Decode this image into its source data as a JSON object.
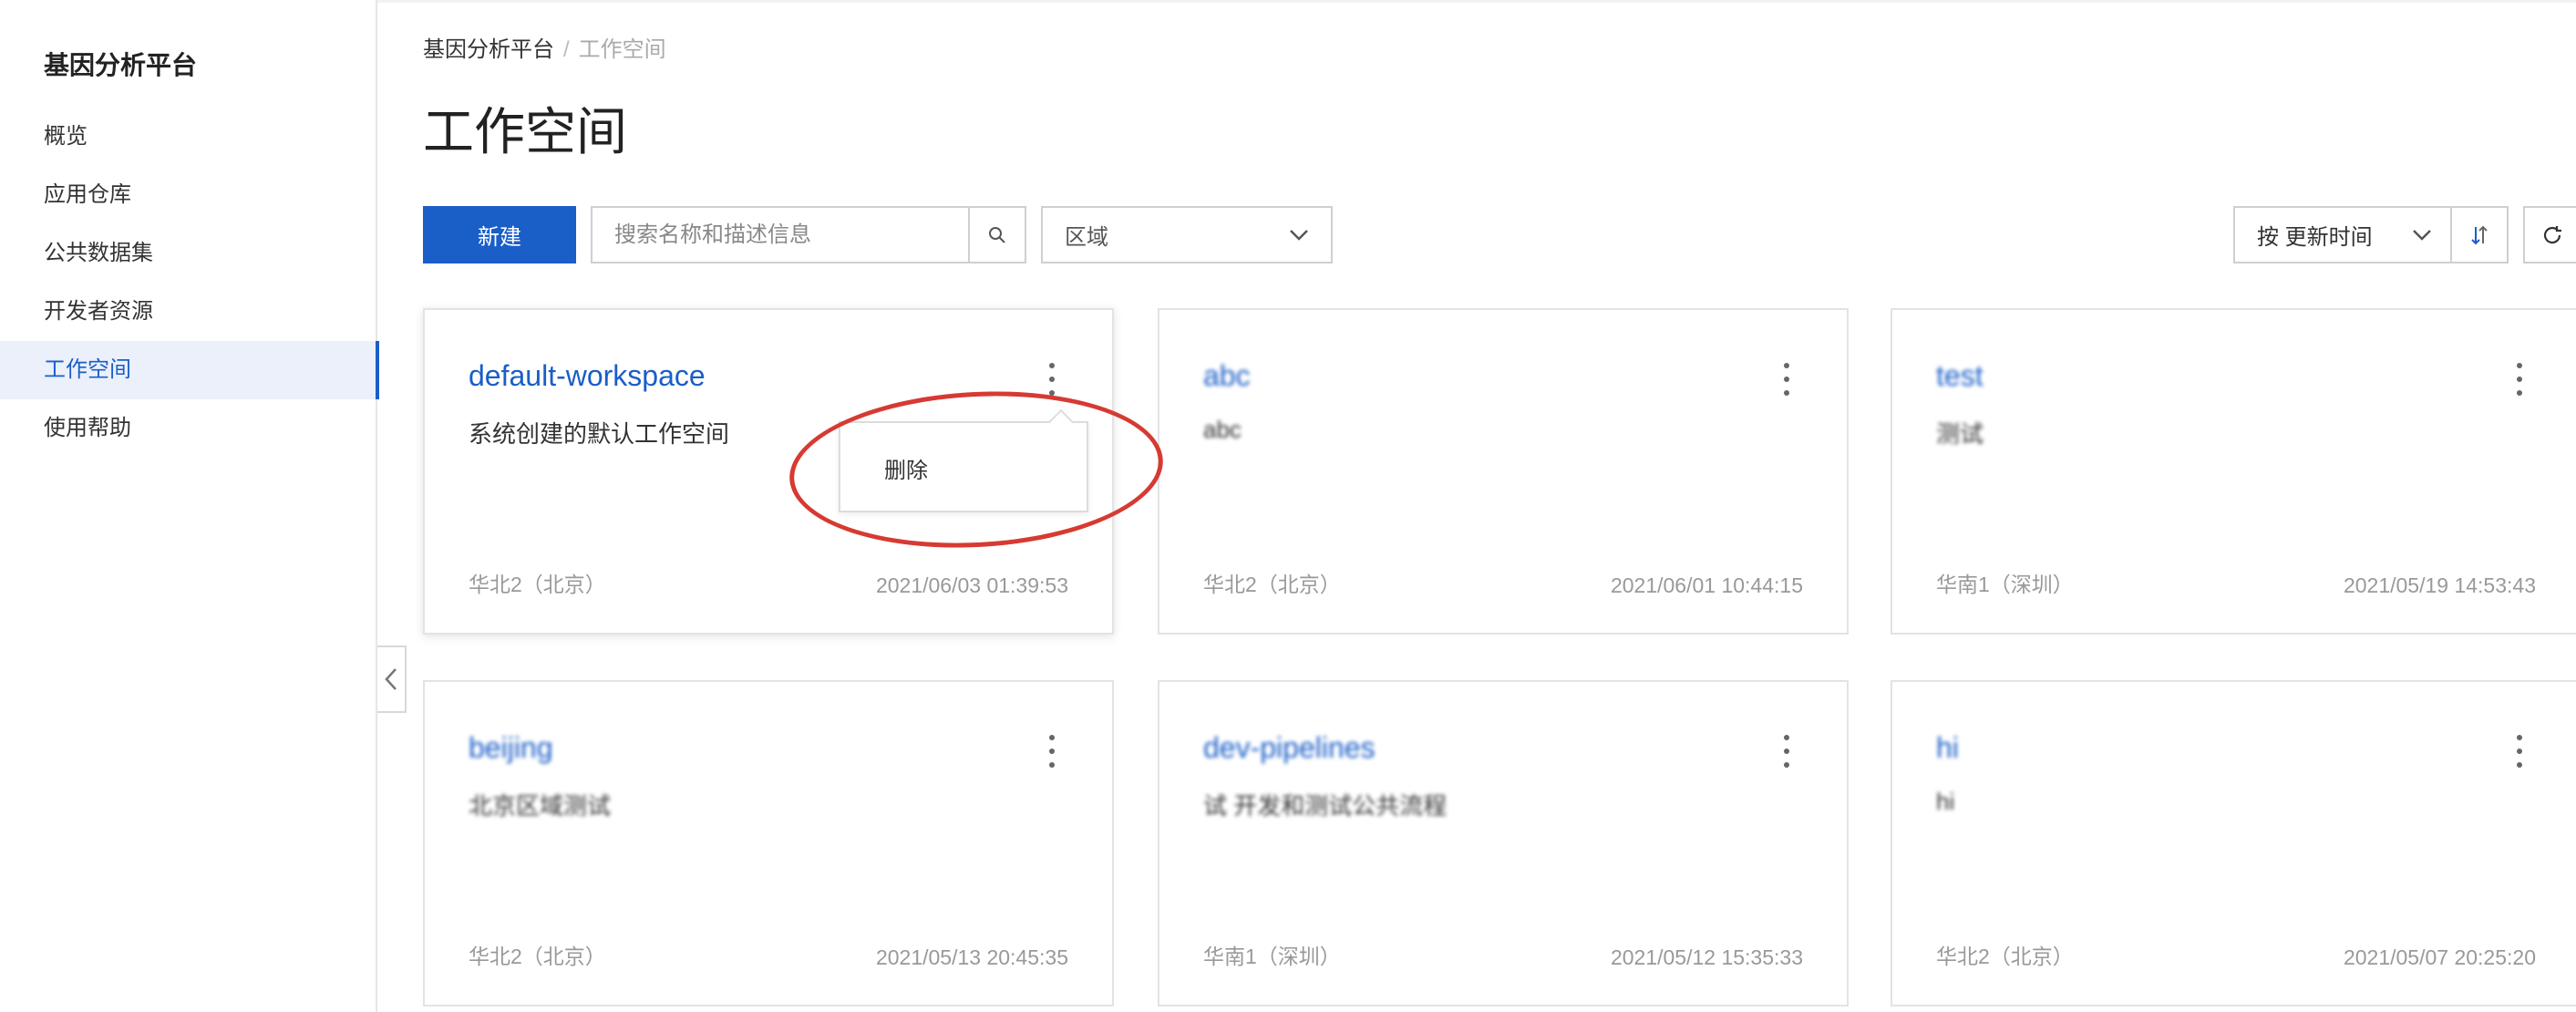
{
  "app": {
    "title": "基因分析平台"
  },
  "sidebar": {
    "items": [
      {
        "label": "概览"
      },
      {
        "label": "应用仓库"
      },
      {
        "label": "公共数据集"
      },
      {
        "label": "开发者资源"
      },
      {
        "label": "工作空间",
        "active": true
      },
      {
        "label": "使用帮助"
      }
    ]
  },
  "breadcrumb": {
    "root": "基因分析平台",
    "separator": "/",
    "current": "工作空间"
  },
  "page": {
    "title": "工作空间"
  },
  "toolbar": {
    "new_label": "新建",
    "search_placeholder": "搜索名称和描述信息",
    "region_select": "区域",
    "sort_select": "按 更新时间"
  },
  "cards": [
    {
      "name": "default-workspace",
      "description": "系统创建的默认工作空间",
      "region": "华北2（北京）",
      "updated": "2021/06/03 01:39:53"
    },
    {
      "name": "abc",
      "description": "abc",
      "region": "华北2（北京）",
      "updated": "2021/06/01 10:44:15"
    },
    {
      "name": "test",
      "description": "测试",
      "region": "华南1（深圳）",
      "updated": "2021/05/19 14:53:43"
    },
    {
      "name": "beijing",
      "description": "北京区域测试",
      "region": "华北2（北京）",
      "updated": "2021/05/13 20:45:35"
    },
    {
      "name": "dev-pipelines",
      "description": "试 开发和测试公共流程",
      "region": "华南1（深圳）",
      "updated": "2021/05/12 15:35:33"
    },
    {
      "name": "hi",
      "description": "hi",
      "region": "华北2（北京）",
      "updated": "2021/05/07 20:25:20"
    }
  ],
  "context_menu": {
    "delete_label": "删除"
  },
  "colors": {
    "primary": "#1a5ec8",
    "annotation": "#d63a32",
    "top_accent": "#ff6a00"
  }
}
